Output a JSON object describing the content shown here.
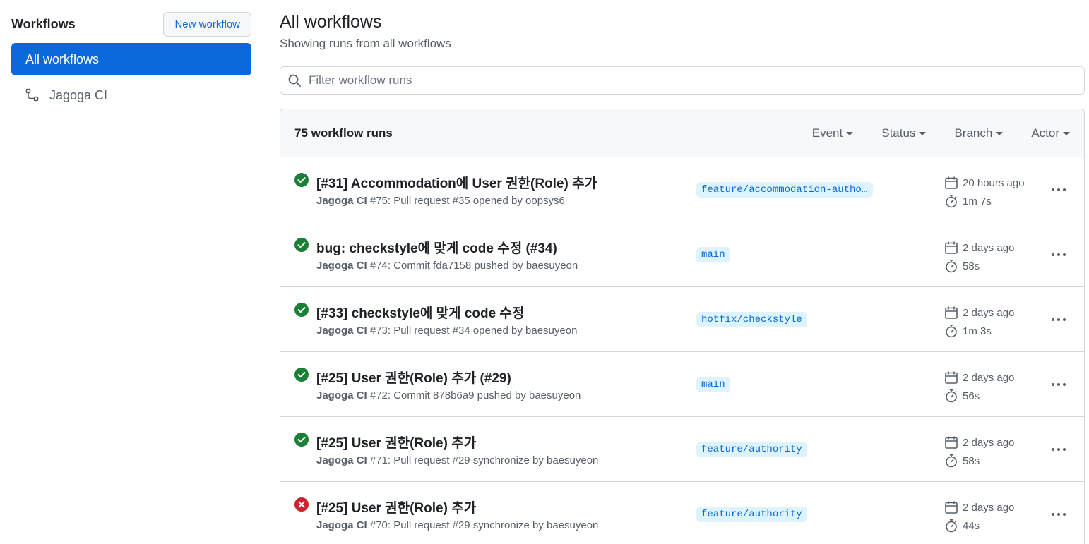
{
  "sidebar": {
    "title": "Workflows",
    "new_workflow_label": "New workflow",
    "active_item": "All workflows",
    "items": [
      {
        "label": "Jagoga CI",
        "icon": "workflow-icon"
      }
    ]
  },
  "main": {
    "title": "All workflows",
    "subtitle": "Showing runs from all workflows",
    "filter_placeholder": "Filter workflow runs",
    "runs_count": "75 workflow runs",
    "filters": [
      "Event",
      "Status",
      "Branch",
      "Actor"
    ]
  },
  "runs": [
    {
      "status": "success",
      "title": "[#31] Accommodation에 User 권한(Role) 추가",
      "workflow": "Jagoga CI",
      "detail": " #75: Pull request #35 opened by oopsys6",
      "branch": "feature/accommodation-authority",
      "when": "20 hours ago",
      "duration": "1m 7s"
    },
    {
      "status": "success",
      "title": "bug: checkstyle에 맞게 code 수정 (#34)",
      "workflow": "Jagoga CI",
      "detail": " #74: Commit fda7158 pushed by baesuyeon",
      "branch": "main",
      "when": "2 days ago",
      "duration": "58s"
    },
    {
      "status": "success",
      "title": "[#33] checkstyle에 맞게 code 수정",
      "workflow": "Jagoga CI",
      "detail": " #73: Pull request #34 opened by baesuyeon",
      "branch": "hotfix/checkstyle",
      "when": "2 days ago",
      "duration": "1m 3s"
    },
    {
      "status": "success",
      "title": "[#25] User 권한(Role) 추가 (#29)",
      "workflow": "Jagoga CI",
      "detail": " #72: Commit 878b6a9 pushed by baesuyeon",
      "branch": "main",
      "when": "2 days ago",
      "duration": "56s"
    },
    {
      "status": "success",
      "title": "[#25] User 권한(Role) 추가",
      "workflow": "Jagoga CI",
      "detail": " #71: Pull request #29 synchronize by baesuyeon",
      "branch": "feature/authority",
      "when": "2 days ago",
      "duration": "58s"
    },
    {
      "status": "failure",
      "title": "[#25] User 권한(Role) 추가",
      "workflow": "Jagoga CI",
      "detail": " #70: Pull request #29 synchronize by baesuyeon",
      "branch": "feature/authority",
      "when": "2 days ago",
      "duration": "44s"
    }
  ],
  "colors": {
    "accent": "#0969da",
    "success": "#1a7f37",
    "failure": "#cf222e",
    "branch_bg": "#ddf4ff"
  }
}
